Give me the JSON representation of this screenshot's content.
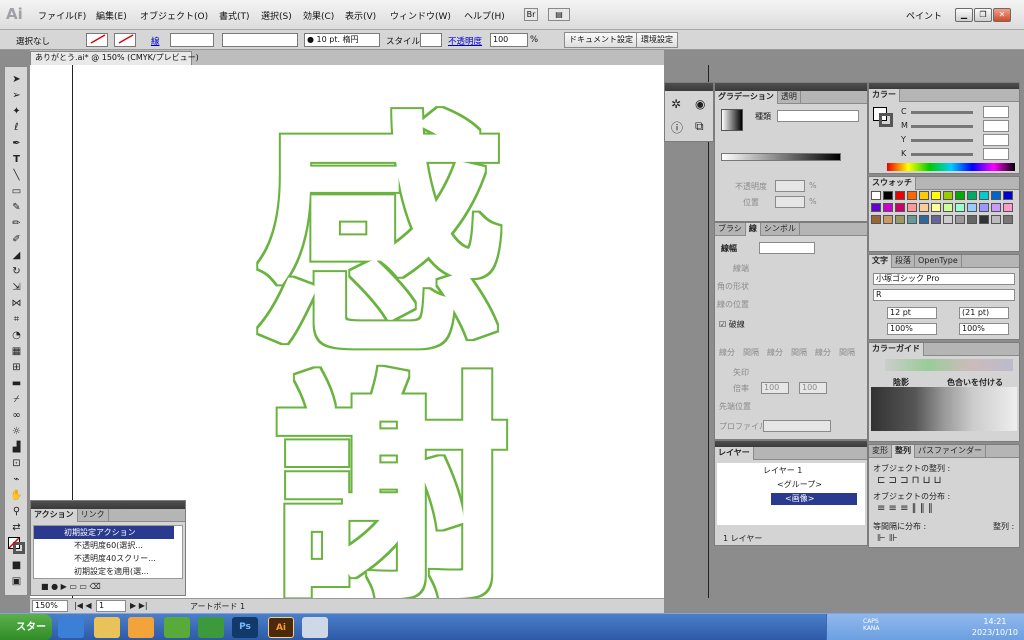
{
  "app": {
    "logo": "Ai",
    "workspace": "ペイント"
  },
  "menu": [
    "ファイル(F)",
    "編集(E)",
    "オブジェクト(O)",
    "書式(T)",
    "選択(S)",
    "効果(C)",
    "表示(V)",
    "ウィンドウ(W)",
    "ヘルプ(H)"
  ],
  "menu_buttons": [
    "Br",
    "▤"
  ],
  "control": {
    "selection": "選択なし",
    "stroke_label": "線",
    "brush_value": "● 10 pt. 楕円",
    "style_label": "スタイル",
    "opacity_label": "不透明度",
    "opacity_value": "100",
    "opacity_unit": "%",
    "document_settings": "ドキュメント設定",
    "preferences": "環境設定"
  },
  "document_tab": "ありがとう.ai* @ 150% (CMYK/プレビュー)",
  "status": {
    "zoom": "150%",
    "artboard_num": "1",
    "artboard_label": "アートボード 1"
  },
  "artwork": {
    "top_word": "感",
    "bottom_word": "謝",
    "stroke_color": "#6bb33f"
  },
  "actions_panel": {
    "tabs": [
      "アクション",
      "リンク"
    ],
    "rows": [
      "初期設定アクション",
      "不透明度60(選択...",
      "不透明度40スクリー...",
      "初期設定を適用(選..."
    ]
  },
  "gradient_panel": {
    "tabs": [
      "グラデーション",
      "透明"
    ],
    "type_label": "種類",
    "opacity_label": "不透明度",
    "position_label": "位置",
    "percent": "%"
  },
  "stroke_panel": {
    "tabs": [
      "ブラシ",
      "線",
      "シンボル"
    ],
    "weight_label": "線幅",
    "cap_label": "線端",
    "corner_label": "角の形状",
    "align_label": "線の位置",
    "dashed_label": "破線",
    "dash_labels": [
      "線分",
      "間隔",
      "線分",
      "間隔",
      "線分",
      "間隔"
    ],
    "arrow_label": "矢印",
    "scale_label": "倍率",
    "scale_values": [
      "100",
      "100"
    ],
    "arrow_pos_label": "先端位置",
    "profile_label": "プロファイル"
  },
  "color_panel": {
    "tab": "カラー",
    "channels": [
      "C",
      "M",
      "Y",
      "K"
    ],
    "unit": "%"
  },
  "swatches_panel": {
    "tab": "スウォッチ"
  },
  "type_panel": {
    "tabs": [
      "文字",
      "段落",
      "OpenType"
    ],
    "font": "小塚ゴシック Pro",
    "weight": "R",
    "size": "12 pt",
    "leading": "(21 pt)",
    "hscale": "100%",
    "vscale": "100%"
  },
  "color_guide": {
    "tab": "カラーガイド",
    "shading": "陰影",
    "warm": "色合いを付ける"
  },
  "layers_panel": {
    "tab": "レイヤー",
    "rows": [
      "レイヤー 1",
      "<グループ>",
      "<画像>"
    ],
    "footer": "1 レイヤー"
  },
  "align_panel": {
    "tabs": [
      "変形",
      "整列",
      "パスファインダー"
    ],
    "align_objects": "オブジェクトの整列 :",
    "distribute_objects": "オブジェクトの分布 :",
    "distribute_spacing": "等間隔に分布 :",
    "align_to": "整列 :"
  },
  "taskbar": {
    "start": "スタート",
    "clock_time": "14:21",
    "clock_date": "2023/10/10",
    "caps": "CAPS",
    "kana": "KANA"
  }
}
